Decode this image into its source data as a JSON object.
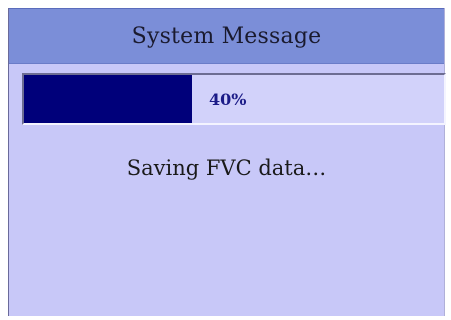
{
  "dialog": {
    "title": "System Message",
    "progress": {
      "value": 0.4,
      "label": "40%",
      "fill_color": "#00007a"
    },
    "message": "Saving FVC data…"
  },
  "colors": {
    "title_bar": "#7b8ed8",
    "dialog_background": "#c8c8f8"
  }
}
